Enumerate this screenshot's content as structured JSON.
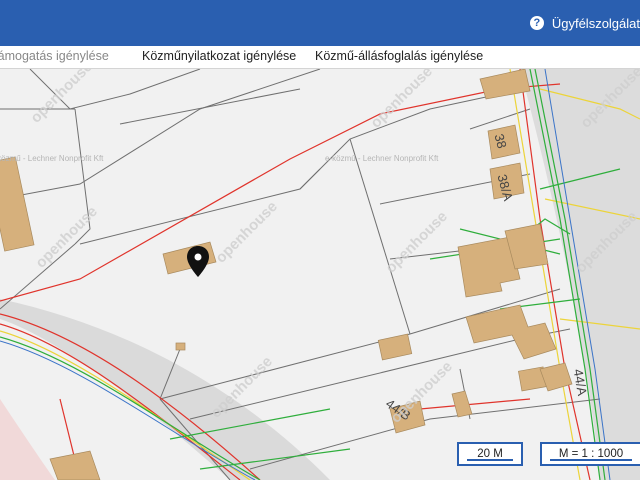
{
  "header": {
    "help_label": "Ügyfélszolgálat",
    "help_glyph": "?"
  },
  "tabs": [
    {
      "label": "Támogatás igénylése"
    },
    {
      "label": "Közműnyilatkozat igénylése"
    },
    {
      "label": "Közmű-állásfoglalás igénylése"
    }
  ],
  "map": {
    "watermark": "openhouse",
    "provider_text": "e-közmű - Lechner Nonprofit Kft",
    "parcel_labels": {
      "p38": "38",
      "p38a": "38/A",
      "p44a": "44/A",
      "p44b": "44/B"
    },
    "colors": {
      "parcel_line": "#6f6f6f",
      "building": "#d6b07c",
      "power_red": "#e0342c",
      "gas_yellow": "#ecd43a",
      "water_green": "#2fae3c",
      "telecom_blue": "#3b74c8",
      "road": "#d9d9d9"
    }
  },
  "controls": {
    "scale_bar_label": "20 M",
    "scale_ratio_label": "M = 1 : 1000"
  }
}
